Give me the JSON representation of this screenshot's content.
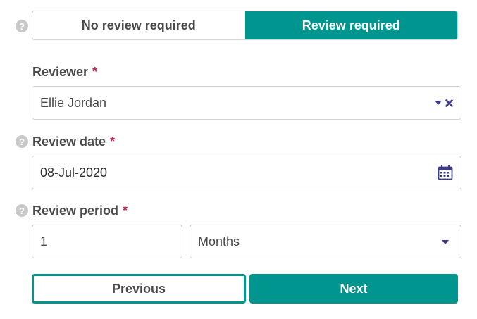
{
  "review_toggle": {
    "options": [
      "No review required",
      "Review required"
    ],
    "selected": "Review required"
  },
  "reviewer": {
    "label": "Reviewer",
    "required_mark": "*",
    "value": "Ellie Jordan"
  },
  "review_date": {
    "label": "Review date",
    "required_mark": "*",
    "value": "08-Jul-2020"
  },
  "review_period": {
    "label": "Review period",
    "required_mark": "*",
    "amount": "1",
    "unit": "Months"
  },
  "buttons": {
    "previous": "Previous",
    "next": "Next"
  },
  "help_glyph": "?",
  "icons": {
    "help": "question-circle-icon",
    "dropdown": "caret-down-icon",
    "clear": "close-icon",
    "calendar": "calendar-icon"
  },
  "colors": {
    "accent": "#00968f",
    "required": "#b8245a",
    "icon": "#3c3b8a"
  }
}
